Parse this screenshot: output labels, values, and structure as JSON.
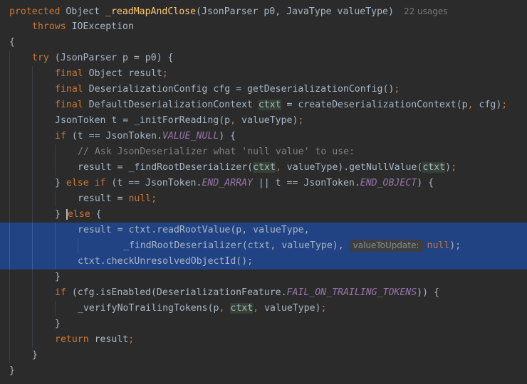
{
  "editor": {
    "colors": {
      "background": "#2b2b2b",
      "selection": "#214283",
      "keyword": "#cc7832",
      "function": "#ffc66d",
      "comment": "#808080",
      "constant": "#9876aa",
      "plain": "#a9b7c6"
    },
    "usages": "22 usages",
    "inlay_hint": "valueToUpdate:",
    "lines": [
      {
        "t": [
          [
            "kw",
            "protected"
          ],
          [
            "p",
            " Object "
          ],
          [
            "fn",
            "_readMapAndClose"
          ],
          [
            "p",
            "(JsonParser p0, JavaType valueType)"
          ]
        ]
      },
      {
        "t": [
          [
            "kw",
            "throws"
          ],
          [
            "p",
            " IOException"
          ]
        ]
      },
      {
        "t": [
          [
            "p",
            "{"
          ]
        ]
      },
      {
        "t": [
          [
            "kw",
            "try"
          ],
          [
            "p",
            " (JsonParser p = p0) {"
          ]
        ]
      },
      {
        "t": [
          [
            "kw",
            "final"
          ],
          [
            "p",
            " Object result"
          ],
          [
            "kw",
            ";"
          ]
        ]
      },
      {
        "t": [
          [
            "kw",
            "final"
          ],
          [
            "p",
            " DeserializationConfig cfg = getDeserializationConfig()"
          ],
          [
            "kw",
            ";"
          ]
        ]
      },
      {
        "t": [
          [
            "kw",
            "final"
          ],
          [
            "p",
            " DefaultDeserializationContext "
          ],
          [
            "hl",
            "ctxt"
          ],
          [
            "p",
            " = createDeserializationContext(p"
          ],
          [
            "kw",
            ","
          ],
          [
            "p",
            " cfg)"
          ],
          [
            "kw",
            ";"
          ]
        ]
      },
      {
        "t": [
          [
            "p",
            "JsonToken t = _initForReading(p"
          ],
          [
            "kw",
            ","
          ],
          [
            "p",
            " valueType)"
          ],
          [
            "kw",
            ";"
          ]
        ]
      },
      {
        "t": [
          [
            "kw",
            "if"
          ],
          [
            "p",
            " (t == JsonToken."
          ],
          [
            "cst",
            "VALUE_NULL"
          ],
          [
            "p",
            ") {"
          ]
        ]
      },
      {
        "t": [
          [
            "cm",
            "// Ask JsonDeserializer what 'null value' to use:"
          ]
        ]
      },
      {
        "t": [
          [
            "p",
            "result = _findRootDeserializer("
          ],
          [
            "hl",
            "ctxt"
          ],
          [
            "kw",
            ","
          ],
          [
            "p",
            " valueType).getNullValue("
          ],
          [
            "hl",
            "ctxt"
          ],
          [
            "p",
            ")"
          ],
          [
            "kw",
            ";"
          ]
        ]
      },
      {
        "t": [
          [
            "p",
            "} "
          ],
          [
            "kw",
            "else if"
          ],
          [
            "p",
            " (t == JsonToken."
          ],
          [
            "cst",
            "END_ARRAY"
          ],
          [
            "p",
            " || t == JsonToken."
          ],
          [
            "cst",
            "END_OBJECT"
          ],
          [
            "p",
            ") {"
          ]
        ]
      },
      {
        "t": [
          [
            "p",
            "result = "
          ],
          [
            "kw",
            "null;"
          ]
        ]
      },
      {
        "t": [
          [
            "p",
            "} "
          ],
          [
            "kw",
            "else"
          ],
          [
            "p",
            " {"
          ]
        ]
      },
      {
        "t": [
          [
            "p",
            "result = ctxt.readRootValue(p, valueType,"
          ]
        ]
      },
      {
        "t": [
          [
            "p",
            "_findRootDeserializer(ctxt, valueType), "
          ],
          [
            "hint",
            ""
          ],
          [
            "kw",
            "null"
          ],
          [
            "p",
            ");"
          ]
        ]
      },
      {
        "t": [
          [
            "p",
            "ctxt.checkUnresolvedObjectId();"
          ]
        ]
      },
      {
        "t": [
          [
            "p",
            "}"
          ]
        ]
      },
      {
        "t": [
          [
            "kw",
            "if"
          ],
          [
            "p",
            " (cfg.isEnabled(DeserializationFeature."
          ],
          [
            "cst",
            "FAIL_ON_TRAILING_TOKENS"
          ],
          [
            "p",
            ")) {"
          ]
        ]
      },
      {
        "t": [
          [
            "p",
            "_verifyNoTrailingTokens(p"
          ],
          [
            "kw",
            ","
          ],
          [
            "p",
            " "
          ],
          [
            "hl",
            "ctxt"
          ],
          [
            "kw",
            ","
          ],
          [
            "p",
            " valueType)"
          ],
          [
            "kw",
            ";"
          ]
        ]
      },
      {
        "t": [
          [
            "p",
            "}"
          ]
        ]
      },
      {
        "t": [
          [
            "kw",
            "return"
          ],
          [
            "p",
            " result"
          ],
          [
            "kw",
            ";"
          ]
        ]
      },
      {
        "t": [
          [
            "p",
            "}"
          ]
        ]
      },
      {
        "t": [
          [
            "p",
            "}"
          ]
        ]
      }
    ]
  }
}
